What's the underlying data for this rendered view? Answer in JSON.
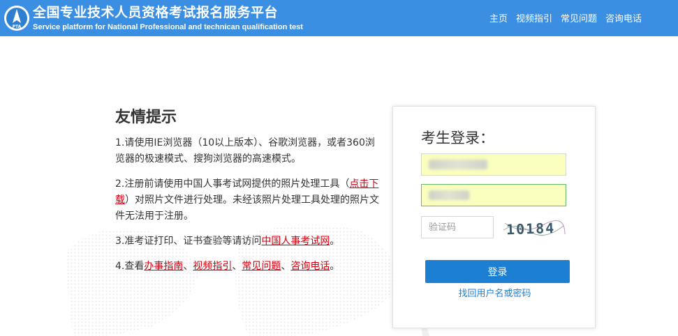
{
  "header": {
    "logo_text": "PTA",
    "title": "全国专业技术人员资格考试报名服务平台",
    "subtitle": "Service platform for National Professional and technican qualification test",
    "nav": [
      {
        "label": "主页"
      },
      {
        "label": "视频指引"
      },
      {
        "label": "常见问题"
      },
      {
        "label": "咨询电话"
      }
    ]
  },
  "tips": {
    "heading": "友情提示",
    "item1": "1.请使用IE浏览器（10以上版本）、谷歌浏览器，或者360浏览器的极速模式、搜狗浏览器的高速模式。",
    "item2_a": "2.注册前请使用中国人事考试网提供的照片处理工具（",
    "item2_link": "点击下载",
    "item2_b": "）对照片文件进行处理。未经该照片处理工具处理的照片文件无法用于注册。",
    "item3_a": "3.准考证打印、证书查验等请访问",
    "item3_link": "中国人事考试网",
    "item3_b": "。",
    "item4_a": "4.查看",
    "item4_links": [
      "办事指南",
      "视频指引",
      "常见问题",
      "咨询电话"
    ],
    "item4_sep": "、",
    "item4_end": "。"
  },
  "login": {
    "title": "考生登录：",
    "captcha_placeholder": "验证码",
    "captcha_text": "10184",
    "submit_label": "登录",
    "forgot_label": "找回用户名或密码"
  },
  "colors": {
    "header_bg": "#3b8fe3",
    "link_red": "#d6000f",
    "button_blue": "#1d7fd1",
    "autofill_yellow": "#faffbd"
  }
}
